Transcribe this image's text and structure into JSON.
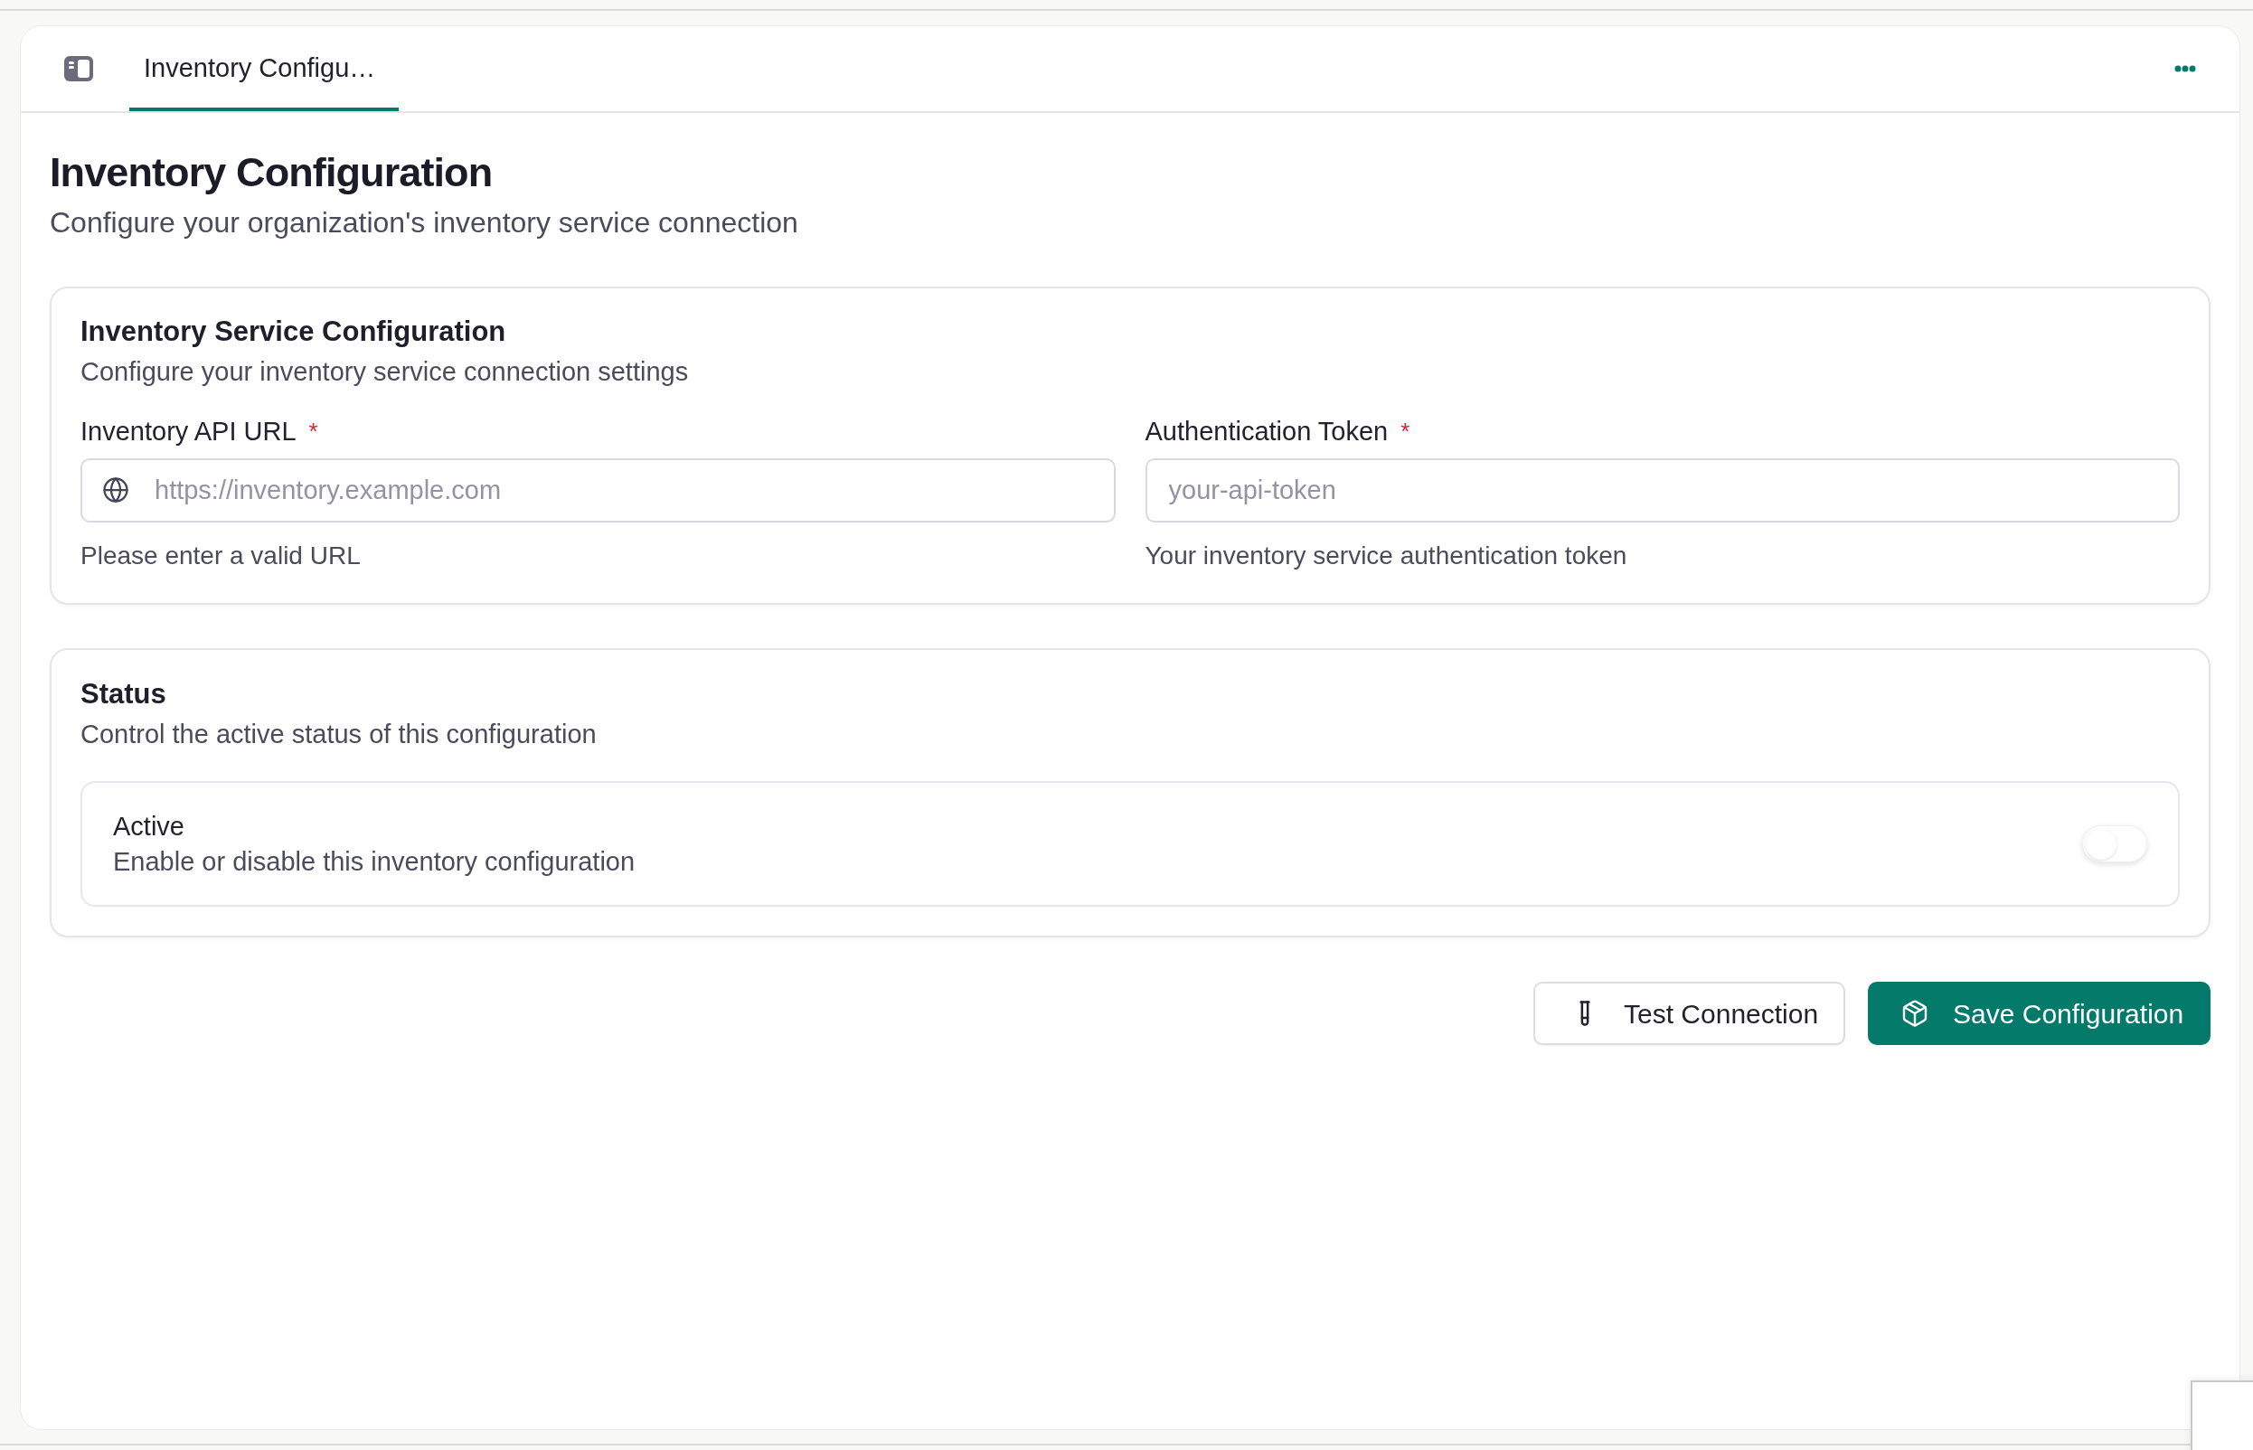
{
  "tabs": [
    {
      "label": "Inventory Configu…",
      "selected": true
    }
  ],
  "page": {
    "title": "Inventory Configuration",
    "subtitle": "Configure your organization's inventory service connection"
  },
  "sections": [
    {
      "kind": "fields",
      "title": "Inventory Service Configuration",
      "description": "Configure your inventory service connection settings",
      "fields": [
        {
          "kind": "url",
          "label": "Inventory API URL",
          "required_mark": "*",
          "placeholder": "https://inventory.example.com",
          "help": "Please enter a valid URL"
        },
        {
          "kind": "token",
          "label": "Authentication Token",
          "required_mark": "*",
          "placeholder": "your-api-token",
          "help": "Your inventory service authentication token"
        }
      ]
    },
    {
      "kind": "toggles",
      "title": "Status",
      "description": "Control the active status of this configuration",
      "toggles": [
        {
          "label": "Active",
          "description": "Enable or disable this inventory configuration",
          "on": false
        }
      ]
    }
  ],
  "actions": [
    {
      "kind": "secondary",
      "label": "Test Connection"
    },
    {
      "kind": "primary",
      "label": "Save Configuration"
    }
  ]
}
